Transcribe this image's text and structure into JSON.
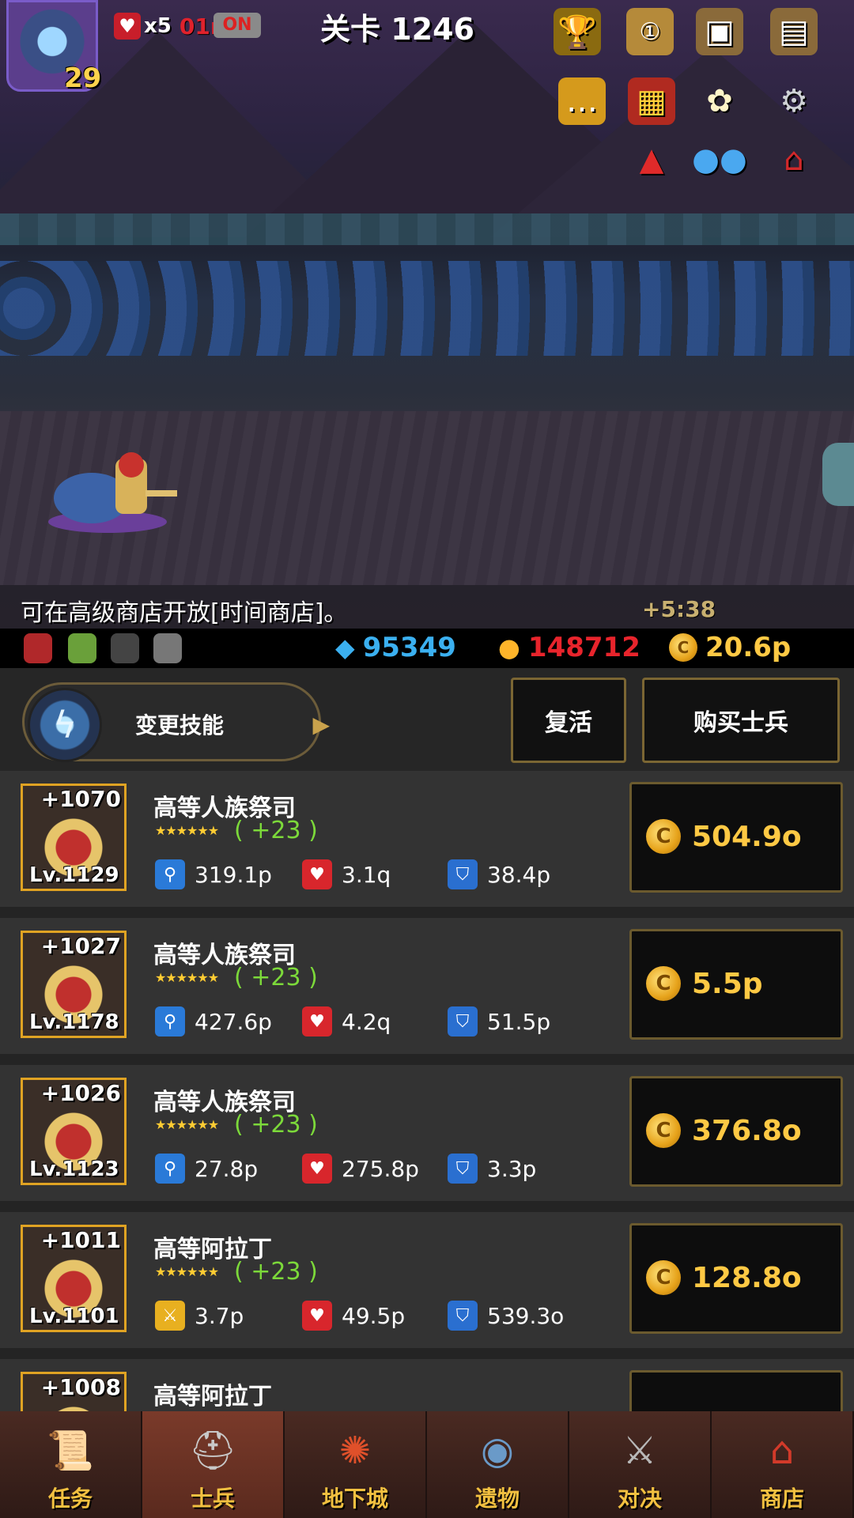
{
  "hud": {
    "player_level": "29",
    "lives_count": "x5",
    "lives_timer": "01m",
    "auto_toggle": "ON",
    "stage": "关卡 1246"
  },
  "ticker": {
    "message": "可在高级商店开放[时间商店]。",
    "float_gain": "+5:38"
  },
  "resources": {
    "gems": "95349",
    "medals": "148712",
    "gold": "20.6p"
  },
  "actions": {
    "skill_label": "变更技能",
    "revive_label": "复活",
    "buy_label": "购买士兵"
  },
  "soldiers": [
    {
      "bonus": "+1070",
      "level": "Lv.1129",
      "name": "高等人族祭司",
      "stars": "★★★★★★",
      "star_bonus": "( +23 )",
      "atk_icon": "magic-wand-icon",
      "atk": "319.1p",
      "hp": "3.1q",
      "def": "38.4p",
      "cost": "504.9o"
    },
    {
      "bonus": "+1027",
      "level": "Lv.1178",
      "name": "高等人族祭司",
      "stars": "★★★★★★",
      "star_bonus": "( +23 )",
      "atk_icon": "magic-wand-icon",
      "atk": "427.6p",
      "hp": "4.2q",
      "def": "51.5p",
      "cost": "5.5p"
    },
    {
      "bonus": "+1026",
      "level": "Lv.1123",
      "name": "高等人族祭司",
      "stars": "★★★★★★",
      "star_bonus": "( +23 )",
      "atk_icon": "magic-wand-icon",
      "atk": "27.8p",
      "hp": "275.8p",
      "def": "3.3p",
      "cost": "376.8o"
    },
    {
      "bonus": "+1011",
      "level": "Lv.1101",
      "name": "高等阿拉丁",
      "stars": "★★★★★★",
      "star_bonus": "( +23 )",
      "atk_icon": "sword-icon",
      "atk": "3.7p",
      "hp": "49.5p",
      "def": "539.3o",
      "cost": "128.8o"
    },
    {
      "bonus": "+1008",
      "level": "",
      "name": "高等阿拉丁",
      "stars": "",
      "star_bonus": "",
      "atk_icon": "sword-icon",
      "atk": "",
      "hp": "",
      "def": "",
      "cost": ""
    }
  ],
  "nav": [
    {
      "label": "任务",
      "icon": "scroll-icon"
    },
    {
      "label": "士兵",
      "icon": "helmet-icon",
      "active": true
    },
    {
      "label": "地下城",
      "icon": "monster-plant-icon"
    },
    {
      "label": "遗物",
      "icon": "orb-icon"
    },
    {
      "label": "对决",
      "icon": "crossed-swords-icon"
    },
    {
      "label": "商店",
      "icon": "shop-icon"
    }
  ],
  "colors": {
    "gold_text": "#ffc944",
    "gem_blue": "#3bb0f0",
    "medal_red": "#e8242c",
    "star_bonus_green": "#7cd93a",
    "portrait_border": "#e0a323"
  }
}
